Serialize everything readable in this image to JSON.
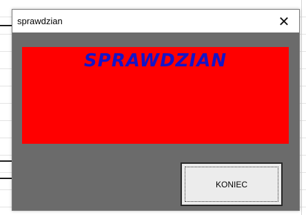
{
  "dialog": {
    "title": "sprawdzian",
    "close_glyph": "✕",
    "close_icon": "close-icon",
    "banner_text": "SPRAWDZIAN",
    "end_button_label": "KONIEC"
  },
  "colors": {
    "dialog_body": "#6b6b6b",
    "banner_background": "#ff0000",
    "banner_text": "#1414c8",
    "button_face": "#ececec"
  }
}
